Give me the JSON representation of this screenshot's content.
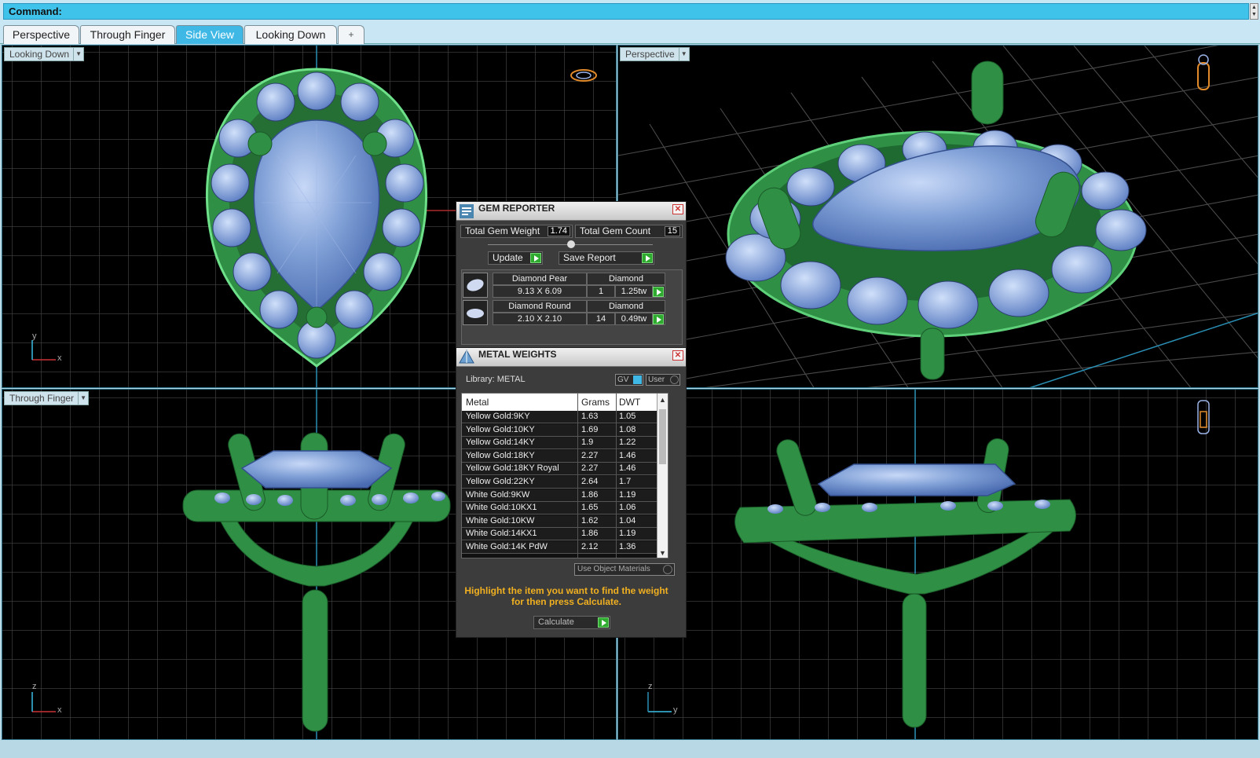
{
  "command": {
    "label": "Command:"
  },
  "tabs": [
    {
      "label": "Perspective",
      "active": false
    },
    {
      "label": "Through Finger",
      "active": false
    },
    {
      "label": "Side View",
      "active": true
    },
    {
      "label": "Looking Down",
      "active": false
    },
    {
      "label": "+",
      "active": false
    }
  ],
  "viewports": {
    "top_left": {
      "label": "Looking Down",
      "axis_v": "y",
      "axis_h": "x"
    },
    "top_right": {
      "label": "Perspective"
    },
    "bottom_left": {
      "label": "Through Finger",
      "axis_v": "z",
      "axis_h": "x"
    },
    "bottom_right": {
      "axis_v": "z",
      "axis_h": "y"
    }
  },
  "gem_reporter": {
    "title": "GEM REPORTER",
    "total_weight_label": "Total Gem Weight",
    "total_weight": "1.74",
    "total_count_label": "Total Gem Count",
    "total_count": "15",
    "update_label": "Update",
    "save_report_label": "Save Report",
    "gems": [
      {
        "name": "Diamond Pear",
        "material": "Diamond",
        "size": "9.13 X 6.09",
        "qty": "1",
        "weight": "1.25tw"
      },
      {
        "name": "Diamond Round",
        "material": "Diamond",
        "size": "2.10 X 2.10",
        "qty": "14",
        "weight": "0.49tw"
      }
    ]
  },
  "metal_weights": {
    "title": "METAL WEIGHTS",
    "library_label": "Library: METAL",
    "gv_label": "GV",
    "user_label": "User",
    "headers": {
      "metal": "Metal",
      "grams": "Grams",
      "dwt": "DWT"
    },
    "rows": [
      {
        "metal": "Yellow Gold:9KY",
        "grams": "1.63",
        "dwt": "1.05"
      },
      {
        "metal": "Yellow Gold:10KY",
        "grams": "1.69",
        "dwt": "1.08"
      },
      {
        "metal": "Yellow Gold:14KY",
        "grams": "1.9",
        "dwt": "1.22"
      },
      {
        "metal": "Yellow Gold:18KY",
        "grams": "2.27",
        "dwt": "1.46"
      },
      {
        "metal": "Yellow Gold:18KY Royal",
        "grams": "2.27",
        "dwt": "1.46"
      },
      {
        "metal": "Yellow Gold:22KY",
        "grams": "2.64",
        "dwt": "1.7"
      },
      {
        "metal": "White Gold:9KW",
        "grams": "1.86",
        "dwt": "1.19"
      },
      {
        "metal": "White Gold:10KX1",
        "grams": "1.65",
        "dwt": "1.06"
      },
      {
        "metal": "White Gold:10KW",
        "grams": "1.62",
        "dwt": "1.04"
      },
      {
        "metal": "White Gold:14KX1",
        "grams": "1.86",
        "dwt": "1.19"
      },
      {
        "metal": "White Gold:14K PdW",
        "grams": "2.12",
        "dwt": "1.36"
      }
    ],
    "use_object_materials_label": "Use Object Materials",
    "note": "Highlight the item you want to find the weight for then press Calculate.",
    "calculate_label": "Calculate"
  },
  "colors": {
    "metal_green": "#2f8f45",
    "gem_blue": "#7f9fd6",
    "grid": "#4a4a4a",
    "accent": "#3fb8e6"
  }
}
